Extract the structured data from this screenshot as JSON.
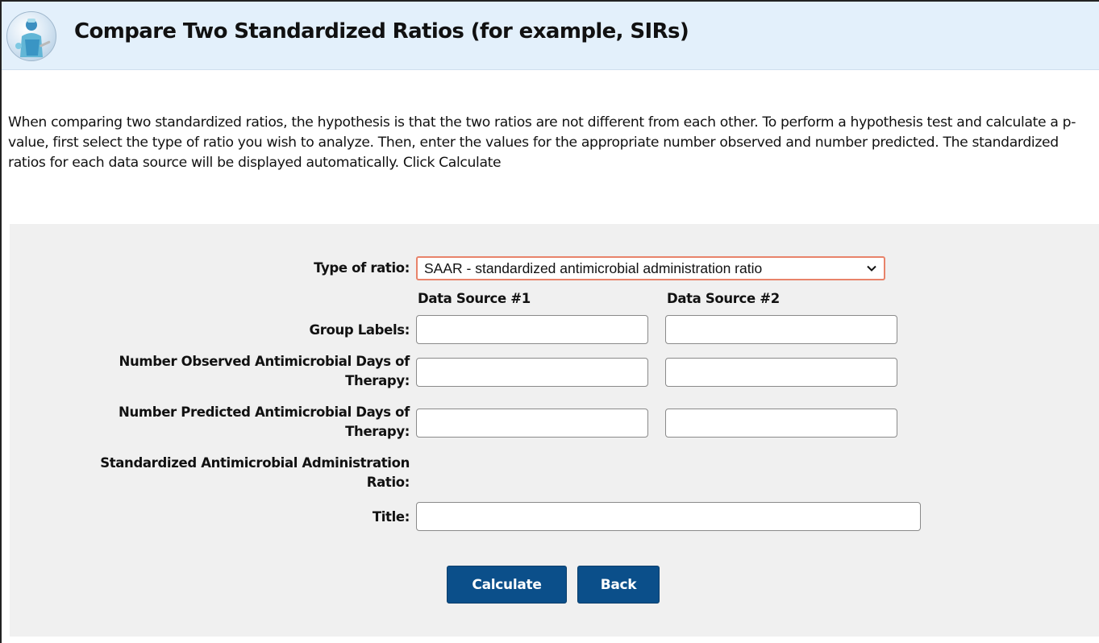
{
  "header": {
    "title": "Compare Two Standardized Ratios (for example, SIRs)",
    "logo_icon": "clinician-logo-icon"
  },
  "intro": {
    "text": "When comparing two standardized ratios, the hypothesis is that the two ratios are not different from each other. To perform a hypothesis test and calculate a p-value, first select the type of ratio you wish to analyze. Then, enter the values for the appropriate number observed and number predicted. The standardized ratios for each data source will be displayed automatically. Click Calculate"
  },
  "form": {
    "ratio_type_label": "Type of ratio:",
    "ratio_type_selected": "SAAR - standardized antimicrobial administration ratio",
    "column_1_header": "Data Source #1",
    "column_2_header": "Data Source #2",
    "group_labels_label": "Group Labels:",
    "group_label_1_value": "",
    "group_label_2_value": "",
    "observed_label_line1": "Number Observed Antimicrobial Days of",
    "observed_label_line2": "Therapy:",
    "observed_1_value": "",
    "observed_2_value": "",
    "predicted_label_line1": "Number Predicted Antimicrobial Days of",
    "predicted_label_line2": "Therapy:",
    "predicted_1_value": "",
    "predicted_2_value": "",
    "ratio_label_line1": "Standardized Antimicrobial Administration",
    "ratio_label_line2": "Ratio:",
    "title_label": "Title:",
    "title_value": ""
  },
  "buttons": {
    "calculate": "Calculate",
    "back": "Back"
  },
  "colors": {
    "header_bg": "#e3f0fb",
    "panel_bg": "#f0f0f0",
    "button_bg": "#0b4f8a",
    "select_focus_border": "#e8836a"
  }
}
